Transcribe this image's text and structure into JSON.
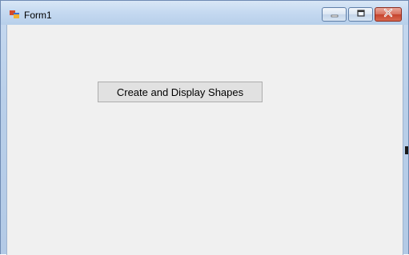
{
  "window": {
    "title": "Form1",
    "icon": "windows-form-icon",
    "controls": {
      "minimize": "minimize-icon",
      "maximize": "maximize-icon",
      "close": "close-icon"
    }
  },
  "form": {
    "button_label": "Create and Display Shapes"
  },
  "colors": {
    "client_background": "#f0f0f0",
    "button_background": "#e1e1e1",
    "title_bar": "#c6daf1",
    "close_button": "#c5432d"
  }
}
